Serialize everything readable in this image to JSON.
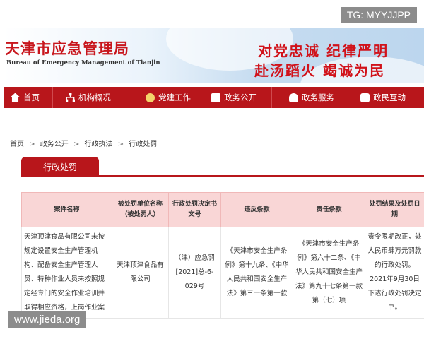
{
  "header": {
    "site_title": "天津市应急管理局",
    "site_subtitle": "Bureau of Emergency Management of Tianjin",
    "slogan_line1": "对党忠诚 纪律严明",
    "slogan_line2": "赴汤蹈火 竭诚为民"
  },
  "watermarks": {
    "top_right": "TG: MYYJJPP",
    "bottom_left": "www.jieda.org"
  },
  "nav": {
    "items": [
      {
        "label": "首页",
        "icon": "home-icon"
      },
      {
        "label": "机构概况",
        "icon": "org-chart-icon"
      },
      {
        "label": "党建工作",
        "icon": "party-emblem-icon"
      },
      {
        "label": "政务公开",
        "icon": "government-affairs-icon"
      },
      {
        "label": "政务服务",
        "icon": "user-service-icon"
      },
      {
        "label": "政民互动",
        "icon": "chat-icon"
      }
    ]
  },
  "breadcrumb": {
    "items": [
      "首页",
      "政务公开",
      "行政执法",
      "行政处罚"
    ],
    "separator": ">"
  },
  "section": {
    "tab_label": "行政处罚"
  },
  "table": {
    "headers": [
      "案件名称",
      "被处罚单位名称（被处罚人）",
      "行政处罚决定书文号",
      "违反条款",
      "责任条款",
      "处罚结果及处罚日期"
    ],
    "rows": [
      {
        "case_name": "天津顶津食品有限公司未按规定设置安全生产管理机构、配备安全生产管理人员、特种作业人员未按照规定经专门的安全作业培训并取得相应资格，上岗作业案",
        "party": "天津顶津食品有限公司",
        "decision_no": "（津）应急罚[2021]总-6-029号",
        "violated": "《天津市安全生产条例》第十九条、《中华人民共和国安全生产法》第三十条第一款",
        "liability": "《天津市安全生产条例》第六十二条、《中华人民共和国安全生产法》第九十七条第一款第（七）项",
        "result": "责令限期改正，处人民币肆万元罚款的行政处罚。2021年9月30日下达行政处罚决定书。"
      }
    ]
  },
  "colors": {
    "brand_red": "#b8161b",
    "header_row": "#f9d6d6"
  }
}
